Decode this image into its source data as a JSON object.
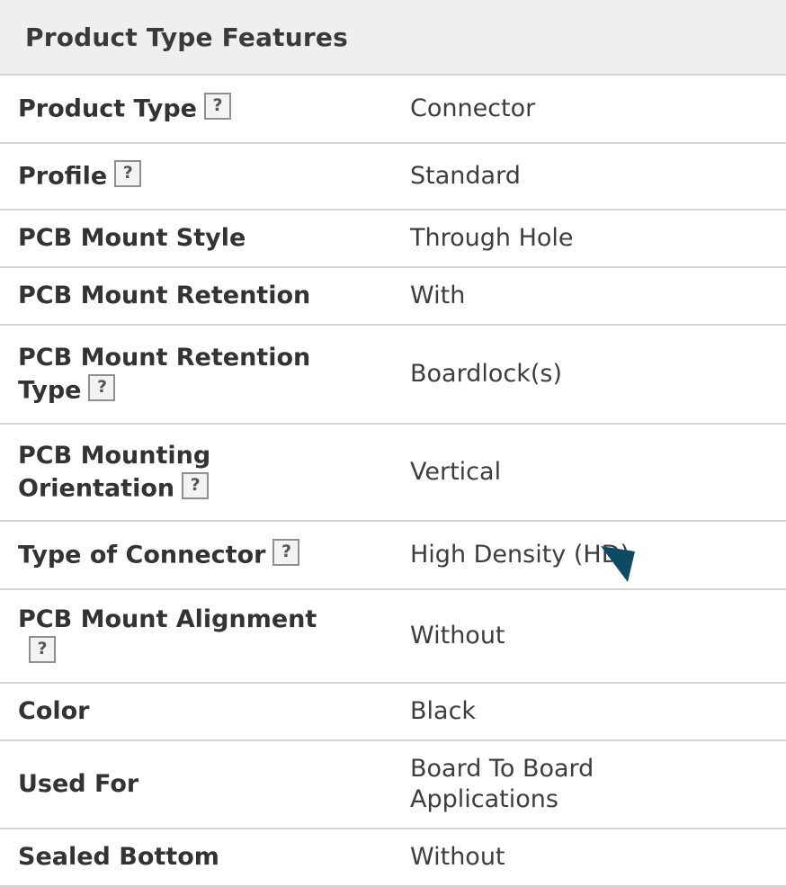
{
  "header": {
    "title": "Product Type Features"
  },
  "help_icon": {
    "glyph": "?",
    "name": "question-mark-help-icon"
  },
  "rows": [
    {
      "label": "Product Type",
      "value": "Connector",
      "help": true
    },
    {
      "label": "Profile",
      "value": "Standard",
      "help": true
    },
    {
      "label": "PCB Mount Style",
      "value": "Through Hole",
      "help": false
    },
    {
      "label": "PCB Mount Retention",
      "value": "With",
      "help": false
    },
    {
      "label": "PCB Mount Retention Type",
      "value": "Boardlock(s)",
      "help": true
    },
    {
      "label": "PCB Mounting Orientation",
      "value": "Vertical",
      "help": true
    },
    {
      "label": "Type of Connector",
      "value": "High Density (HD)",
      "help": true
    },
    {
      "label": "PCB Mount Alignment",
      "value": "Without",
      "help": true
    },
    {
      "label": "Color",
      "value": "Black",
      "help": false
    },
    {
      "label": "Used For",
      "value": "Board To Board Applications",
      "help": false
    },
    {
      "label": "Sealed Bottom",
      "value": "Without",
      "help": false
    }
  ],
  "colors": {
    "header_bg": "#efefef",
    "divider": "#d4d4d4",
    "text": "#333333",
    "cursor": "#0d4a63"
  }
}
